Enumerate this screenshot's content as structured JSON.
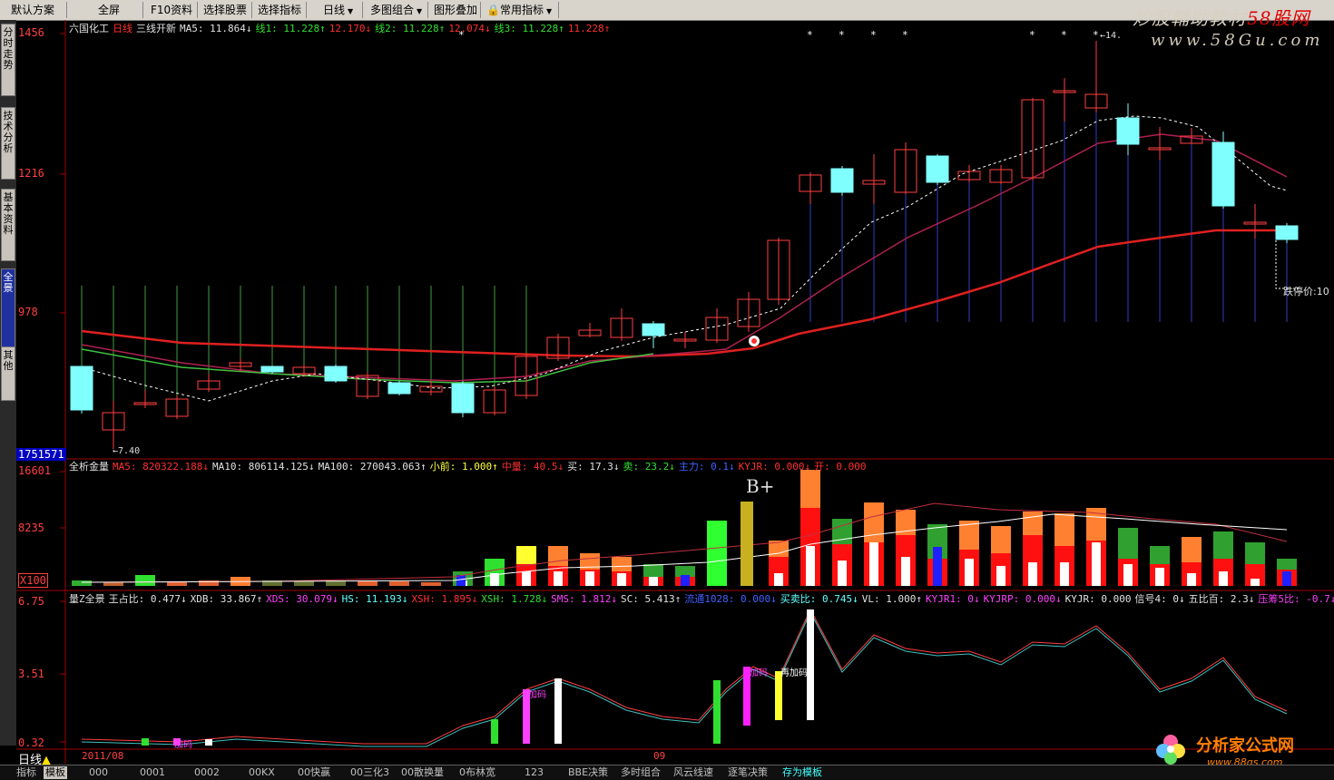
{
  "toolbar": {
    "items": [
      "默认方案",
      "全屏",
      "F10资料",
      "选择股票",
      "选择指标",
      "日线",
      "多图组合",
      "图形叠加",
      "常用指标"
    ]
  },
  "watermark": {
    "line1_a": "炒股輔助教材",
    "line1_b": "58股网",
    "line2": "www.58Gu.com",
    "bottom_logo": "分析家公式网",
    "bottom_url": "www.88gs.com"
  },
  "left_tabs": [
    "分时走势",
    "技术分析",
    "基本资料",
    "全景",
    "其他"
  ],
  "price_panel": {
    "name": "六国化工",
    "period": "日线",
    "indicator": "三线开新",
    "ma5": "MA5: 11.864↓",
    "line1": "线1: 11.228↑",
    "line1b": "12.170↓",
    "line2": "线2: 11.228↑",
    "line2b": "12.074↓",
    "line3": "线3: 11.228↑",
    "line3b": "11.228↑",
    "y_labels": [
      "1456",
      "1216",
      "978"
    ],
    "low_label": "←7.40",
    "high_label": "←14.",
    "limit_label": "跌停价:10",
    "vol_box": "1751571"
  },
  "vol_panel": {
    "title": "全析金量",
    "ma5": "MA5: 820322.188↓",
    "ma10": "MA10: 806114.125↓",
    "ma100": "MA100: 270043.063↑",
    "small": "小前: 1.000↑",
    "d1": "中量: 40.5↓",
    "buy": "买: 17.3↓",
    "sell": "卖: 23.2↓",
    "d2": "主力: 0.1↓",
    "kyjr": "KYJR: 0.000↓",
    "d3": "开: 0.000",
    "y_labels": [
      "16601",
      "8235",
      "X100"
    ],
    "bplus": "B+"
  },
  "ind_panel": {
    "title": "量Z全景",
    "zzb": "王占比: 0.477↓",
    "xdb": "XDB: 33.867↑",
    "xds": "XDS: 30.079↓",
    "hs": "HS: 11.193↓",
    "xsh": "XSH: 1.895↓",
    "xsh2": "XSH: 1.728↓",
    "sms": "SMS: 1.812↓",
    "sc": "SC: 5.413↑",
    "lj": "流通1028: 0.000↓",
    "mmb": "买卖比: 0.745↓",
    "vl": "VL: 1.000↑",
    "kyjr1": "KYJR1: 0↓",
    "kyjr2": "KYJRP: 0.000↓",
    "kyjr3": "KYJR: 0.000",
    "sig": "信号4: 0↓",
    "wbb": "五比百: 2.3↓",
    "yc": "压筹5比: -0.7↓",
    "y_labels": [
      "6.75",
      "3.51",
      "0.32"
    ],
    "bar_labels": [
      "加码",
      "加码",
      "加码",
      "再加码"
    ],
    "date_left": "2011/08",
    "date_mid": "09"
  },
  "bottom": {
    "period": "日线",
    "tabs": [
      "指标",
      "模板",
      "000",
      "0001",
      "0002",
      "00KX",
      "00快赢",
      "00三化3",
      "00散换量",
      "0布林宽",
      "123",
      "BBE决策",
      "多时组合",
      "风云线速",
      "逐笔决策",
      "存为模板"
    ]
  },
  "colors": {
    "up": "#ff4040",
    "down_fill": "#80ffff",
    "ma_long": "#e02020",
    "ma_mid": "#b02050",
    "ma_green": "#40c040"
  }
}
